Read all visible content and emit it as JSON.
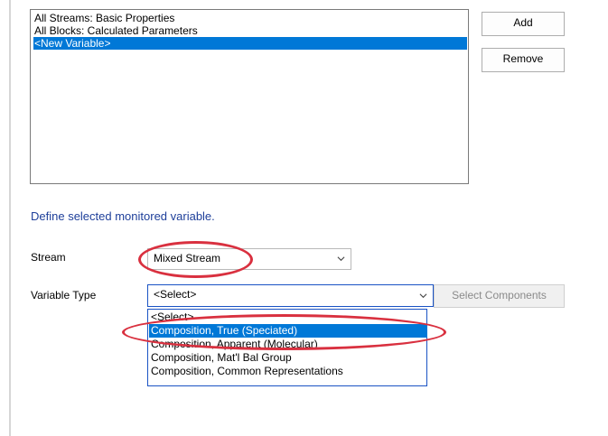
{
  "variables_list": {
    "items": [
      "All Streams: Basic Properties",
      "All Blocks: Calculated Parameters",
      "<New Variable>"
    ],
    "selected_index": 2
  },
  "buttons": {
    "add_label": "Add",
    "remove_label": "Remove",
    "select_components_label": "Select Components"
  },
  "define_hint": "Define selected monitored variable.",
  "stream": {
    "label": "Stream",
    "value": "Mixed Stream"
  },
  "variable_type": {
    "label": "Variable Type",
    "value": "<Select>",
    "options": [
      "<Select>",
      "Composition, True (Speciated)",
      "Composition, Apparent (Molecular)",
      "Composition, Mat'l Bal Group",
      "Composition, Common Representations"
    ],
    "highlighted_index": 1
  },
  "colors": {
    "selection": "#0078d7",
    "annotation": "#d9303f",
    "hint_text": "#1e3f9a"
  }
}
